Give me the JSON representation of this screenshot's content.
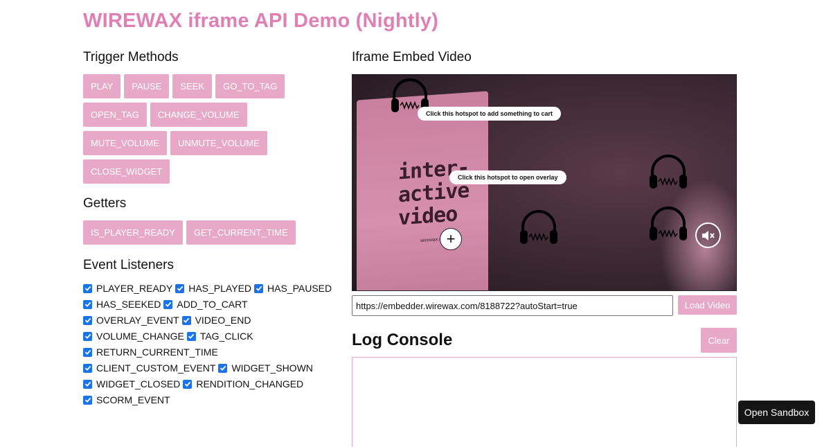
{
  "page": {
    "title": "WIREWAX iframe API Demo (Nightly)"
  },
  "trigger_methods": {
    "heading": "Trigger Methods",
    "buttons": [
      "PLAY",
      "PAUSE",
      "SEEK",
      "GO_TO_TAG",
      "OPEN_TAG",
      "CHANGE_VOLUME",
      "MUTE_VOLUME",
      "UNMUTE_VOLUME",
      "CLOSE_WIDGET"
    ]
  },
  "getters": {
    "heading": "Getters",
    "buttons": [
      "IS_PLAYER_READY",
      "GET_CURRENT_TIME"
    ]
  },
  "event_listeners": {
    "heading": "Event Listeners",
    "items": [
      {
        "label": "PLAYER_READY",
        "checked": true
      },
      {
        "label": "HAS_PLAYED",
        "checked": true
      },
      {
        "label": "HAS_PAUSED",
        "checked": true
      },
      {
        "label": "HAS_SEEKED",
        "checked": true
      },
      {
        "label": "ADD_TO_CART",
        "checked": true
      },
      {
        "label": "OVERLAY_EVENT",
        "checked": true
      },
      {
        "label": "VIDEO_END",
        "checked": true
      },
      {
        "label": "VOLUME_CHANGE",
        "checked": true
      },
      {
        "label": "TAG_CLICK",
        "checked": true
      },
      {
        "label": "RETURN_CURRENT_TIME",
        "checked": true
      },
      {
        "label": "CLIENT_CUSTOM_EVENT",
        "checked": true
      },
      {
        "label": "WIDGET_SHOWN",
        "checked": true
      },
      {
        "label": "WIDGET_CLOSED",
        "checked": true
      },
      {
        "label": "RENDITION_CHANGED",
        "checked": true
      },
      {
        "label": "SCORM_EVENT",
        "checked": true
      }
    ]
  },
  "embed": {
    "heading": "Iframe Embed Video",
    "video": {
      "card_text": "inter-\nactive\nvideo",
      "card_small_text": "wirewax.com",
      "hotspot_cart": "Click this hotspot to add something to cart",
      "hotspot_overlay": "Click this hotspot to open overlay",
      "plus_icon": "plus-icon",
      "mute_icon": "speaker-muted-icon",
      "hotspot_icon": "headphones-icon"
    },
    "url_value": "https://embedder.wirewax.com/8188722?autoStart=true",
    "load_label": "Load Video"
  },
  "log_console": {
    "heading": "Log Console",
    "clear_label": "Clear"
  },
  "sandbox_label": "Open Sandbox",
  "colors": {
    "accent": "#e07fb4",
    "button_bg": "#e8a9c8",
    "checkbox": "#1a73e8"
  }
}
